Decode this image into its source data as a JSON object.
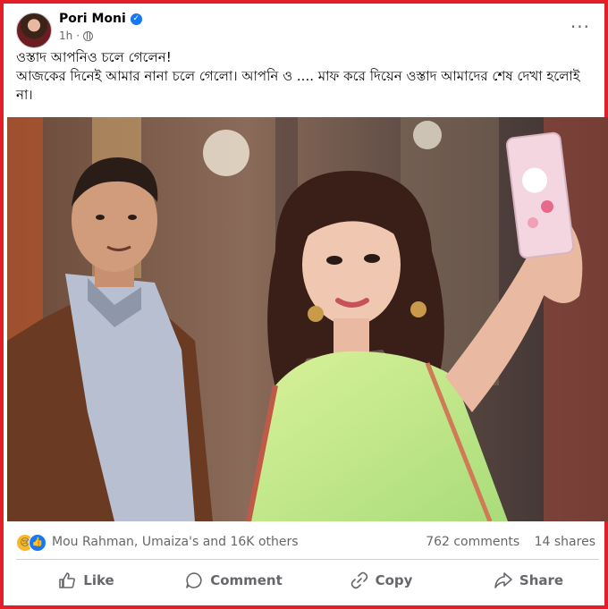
{
  "post": {
    "author": "Pori Moni",
    "time": "1h",
    "text_lines": [
      "ওস্তাদ আপনিও চলে গেলেন!",
      "আজকের দিনেই আমার নানা চলে গেলো। আপনি ও .... মাফ করে দিয়েন ওস্তাদ আমাদের শেষ দেখা হলোই না।"
    ]
  },
  "stats": {
    "reactors": "Mou Rahman, Umaiza's and 16K others",
    "comments": "762 comments",
    "shares": "14 shares"
  },
  "actions": {
    "like": "Like",
    "comment": "Comment",
    "copy": "Copy",
    "share": "Share"
  },
  "icons": [
    "avatar",
    "verified-icon",
    "globe-icon",
    "more-options-icon",
    "sad-reaction-icon",
    "like-reaction-icon",
    "like-icon",
    "comment-icon",
    "copy-link-icon",
    "share-icon"
  ],
  "colors": {
    "frame_border": "#e41e26",
    "secondary_text": "#65676b",
    "facebook_blue": "#1877f2",
    "saree_green": "#b9e58a"
  }
}
